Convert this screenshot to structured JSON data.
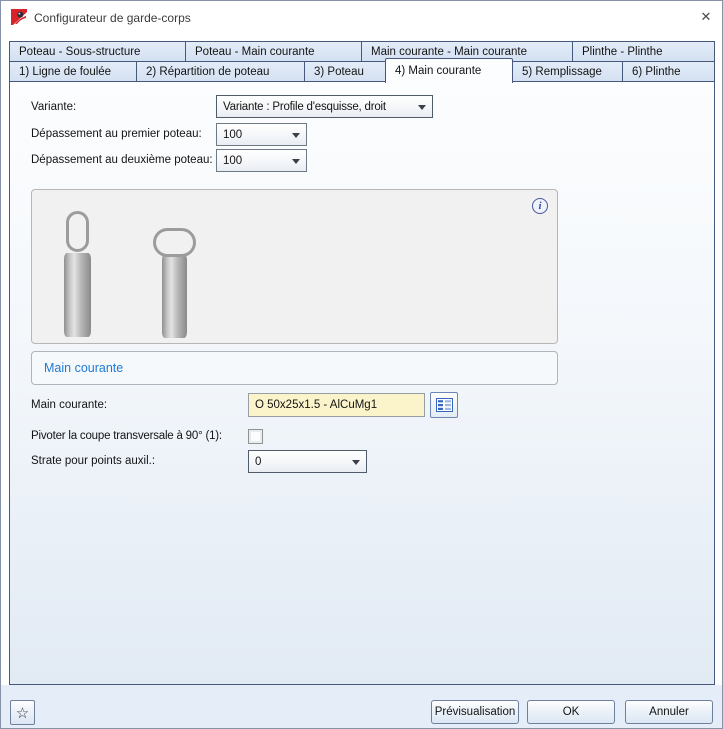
{
  "window": {
    "title": "Configurateur de garde-corps"
  },
  "icons": {
    "close": "✕",
    "favorite": "☆",
    "info": "i"
  },
  "tabs_row1": [
    {
      "label": "Poteau - Sous-structure"
    },
    {
      "label": "Poteau - Main courante"
    },
    {
      "label": "Main courante - Main courante"
    },
    {
      "label": "Plinthe - Plinthe"
    }
  ],
  "tabs_row2": [
    {
      "label": "1) Ligne de foulée"
    },
    {
      "label": "2) Répartition de poteau"
    },
    {
      "label": "3) Poteau"
    },
    {
      "label": "4) Main courante",
      "active": true
    },
    {
      "label": "5) Remplissage"
    },
    {
      "label": "6) Plinthe"
    }
  ],
  "form": {
    "variante_label": "Variante:",
    "variante_value": "Variante : Profile d'esquisse, droit",
    "depassement1_label": "Dépassement au premier poteau:",
    "depassement1_value": "100",
    "depassement2_label": "Dépassement au deuxième poteau:",
    "depassement2_value": "100"
  },
  "preview": {
    "caption": "Main courante"
  },
  "details": {
    "main_courante_label": "Main courante:",
    "main_courante_value": "O 50x25x1.5 - AlCuMg1",
    "pivoter_label": "Pivoter la coupe transversale à 90° (1):",
    "pivoter_checked": false,
    "strate_label": "Strate pour points auxil.:",
    "strate_value": "0"
  },
  "footer": {
    "preview_label": "Prévisualisation",
    "ok_label": "OK",
    "cancel_label": "Annuler"
  },
  "colors": {
    "brand_red": "#d8232a",
    "tab_fill": "#dbe5f4",
    "tab_border": "#46597c",
    "field_yellow": "#fbf4cb",
    "link_blue": "#1f7ad4",
    "footer_bg": "#e5edf8"
  }
}
